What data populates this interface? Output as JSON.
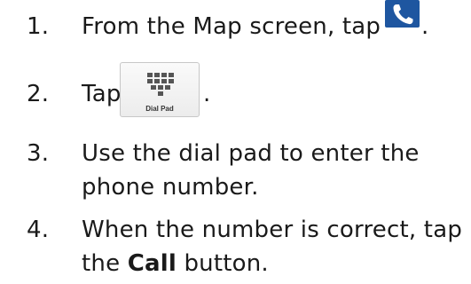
{
  "steps": [
    {
      "number": "1.",
      "text_before": "From the Map screen, tap",
      "text_after": "."
    },
    {
      "number": "2.",
      "text_before": "Tap",
      "text_after": "."
    },
    {
      "number": "3.",
      "line1": "Use the dial pad to enter the",
      "line2": "phone number."
    },
    {
      "number": "4.",
      "line1": "When the number is correct, tap",
      "line2_before": "the ",
      "line2_bold": "Call",
      "line2_after": " button."
    }
  ],
  "icons": {
    "phone": "phone-icon",
    "dial_pad": "dial-pad-icon"
  },
  "dial_pad_button": {
    "label": "Dial Pad"
  },
  "colors": {
    "phone_icon_bg": "#1e56a0",
    "text": "#1a1a1a"
  }
}
